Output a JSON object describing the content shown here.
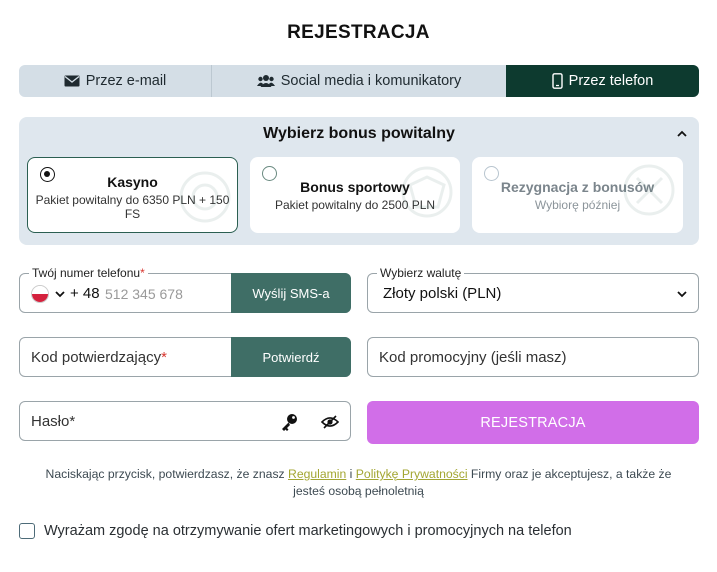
{
  "title": "REJESTRACJA",
  "tabs": [
    {
      "label": "Przez e-mail",
      "icon": "envelope-icon",
      "active": false
    },
    {
      "label": "Social media i komunikatory",
      "icon": "users-icon",
      "active": false
    },
    {
      "label": "Przez telefon",
      "icon": "phone-icon",
      "active": true
    }
  ],
  "bonus": {
    "heading": "Wybierz bonus powitalny",
    "options": [
      {
        "title": "Kasyno",
        "subtitle": "Pakiet powitalny do 6350 PLN + 150 FS",
        "selected": true
      },
      {
        "title": "Bonus sportowy",
        "subtitle": "Pakiet powitalny do 2500 PLN",
        "selected": false
      },
      {
        "title": "Rezygnacja z bonusów",
        "subtitle": "Wybiorę później",
        "selected": false
      }
    ]
  },
  "phone": {
    "label": "Twój numer telefonu",
    "required_mark": "*",
    "prefix": "+ 48",
    "placeholder": "512 345 678",
    "send_sms_label": "Wyślij SMS-a"
  },
  "currency": {
    "label": "Wybierz walutę",
    "value": "Złoty polski (PLN)"
  },
  "code": {
    "placeholder": "Kod potwierdzający",
    "required_mark": "*",
    "confirm_label": "Potwierdź"
  },
  "promo": {
    "placeholder": "Kod promocyjny (jeśli masz)"
  },
  "password": {
    "placeholder": "Hasło*"
  },
  "register_label": "REJESTRACJA",
  "terms": {
    "before": "Naciskając przycisk, potwierdzasz, że znasz ",
    "link1": "Regulamin",
    "mid": " i ",
    "link2": "Politykę Prywatności",
    "after": " Firmy oraz je akceptujesz, a także że jesteś osobą pełnoletnią"
  },
  "consent": "Wyrażam zgodę na otrzymywanie ofert marketingowych i promocyjnych na telefon",
  "colors": {
    "active_tab": "#0d3a2f",
    "green_button": "#3f6e66",
    "register_button": "#d16ee8",
    "link": "#a3a632",
    "required": "#d8362f"
  }
}
